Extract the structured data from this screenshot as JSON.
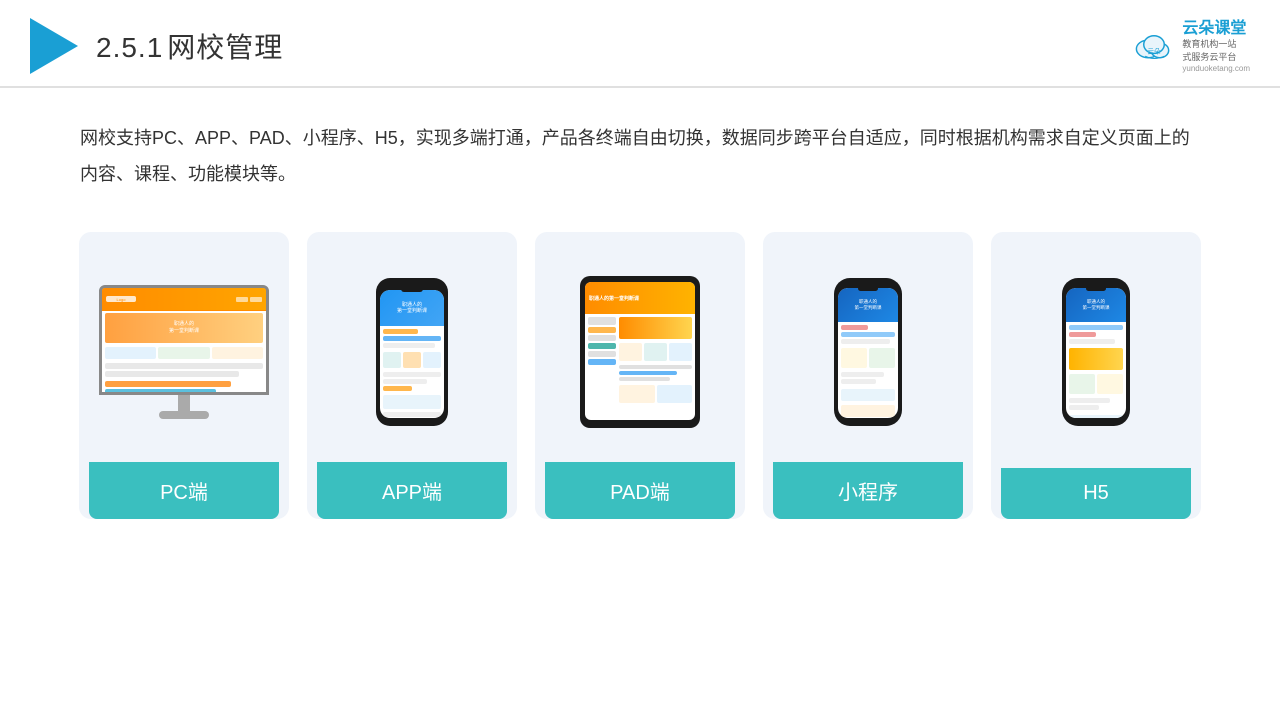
{
  "header": {
    "title": "2.5.1网校管理",
    "title_num": "2.5.1",
    "title_text": "网校管理"
  },
  "brand": {
    "name": "云朵课堂",
    "sub_line1": "教育机构一站",
    "sub_line2": "式服务云平台",
    "domain": "yunduoketang.com"
  },
  "description": "网校支持PC、APP、PAD、小程序、H5，实现多端打通，产品各终端自由切换，数据同步跨平台自适应，同时根据机构需求自定义页面上的内容、课程、功能模块等。",
  "cards": [
    {
      "id": "pc",
      "label": "PC端"
    },
    {
      "id": "app",
      "label": "APP端"
    },
    {
      "id": "pad",
      "label": "PAD端"
    },
    {
      "id": "miniprogram",
      "label": "小程序"
    },
    {
      "id": "h5",
      "label": "H5"
    }
  ]
}
